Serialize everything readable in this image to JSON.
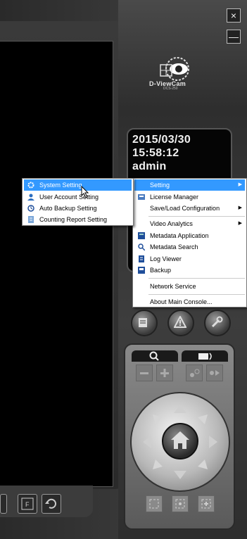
{
  "window": {
    "close_icon": "×",
    "minimize_icon": "—"
  },
  "logo": {
    "name": "D-ViewCam",
    "model": "DCS-250"
  },
  "status": {
    "date": "2015/03/30",
    "time": "15:58:12",
    "user": "admin"
  },
  "main_menu": [
    {
      "label": "Setting",
      "icon": "",
      "submenu": true,
      "selected": true
    },
    {
      "label": "License Manager",
      "icon": "license-icon",
      "submenu": false
    },
    {
      "label": "Save/Load Configuration",
      "icon": "",
      "submenu": true
    },
    {
      "separator": true
    },
    {
      "label": "Video Analytics",
      "icon": "",
      "submenu": true
    },
    {
      "label": "Metadata Application",
      "icon": "metadata-application-icon",
      "submenu": false
    },
    {
      "label": "Metadata Search",
      "icon": "metadata-search-icon",
      "submenu": false
    },
    {
      "label": "Log Viewer",
      "icon": "log-viewer-icon",
      "submenu": false
    },
    {
      "label": "Backup",
      "icon": "backup-icon",
      "submenu": false
    },
    {
      "separator": true
    },
    {
      "label": "Network Service",
      "icon": "",
      "submenu": false
    },
    {
      "separator": true
    },
    {
      "label": "About Main Console...",
      "icon": "",
      "submenu": false
    }
  ],
  "setting_submenu": [
    {
      "label": "System Setting",
      "icon": "system-setting-icon",
      "selected": true
    },
    {
      "label": "User Account Setting",
      "icon": "user-account-icon"
    },
    {
      "label": "Auto Backup Setting",
      "icon": "auto-backup-icon"
    },
    {
      "label": "Counting Report Setting",
      "icon": "counting-report-icon"
    }
  ]
}
